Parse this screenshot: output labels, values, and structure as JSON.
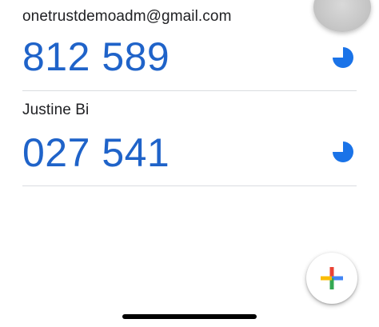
{
  "accounts": [
    {
      "name": "onetrustdemoadm@gmail.com",
      "code": "812 589",
      "timer_remaining_fraction": 0.75
    },
    {
      "name": "Justine Bi",
      "code": "027 541",
      "timer_remaining_fraction": 0.75
    }
  ],
  "fab": {
    "icon": "plus-icon"
  },
  "colors": {
    "code_blue": "#1f63c9",
    "timer_blue": "#1a73e8",
    "divider": "#dadce0",
    "plus_blue": "#4285F4",
    "plus_red": "#EA4335",
    "plus_yellow": "#FBBC04",
    "plus_green": "#34A853"
  }
}
